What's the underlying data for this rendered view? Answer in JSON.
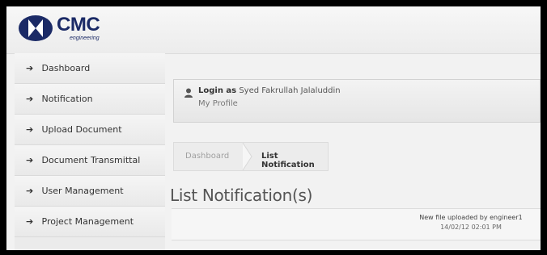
{
  "brand": {
    "name": "CMC",
    "subtitle": "engineering"
  },
  "sidebar": {
    "items": [
      {
        "label": "Dashboard"
      },
      {
        "label": "Notification"
      },
      {
        "label": "Upload Document"
      },
      {
        "label": "Document Transmittal"
      },
      {
        "label": "User Management"
      },
      {
        "label": "Project Management"
      }
    ]
  },
  "login": {
    "prefix": "Login as",
    "user": "Syed Fakrullah Jalaluddin",
    "profile_link": "My Profile"
  },
  "breadcrumb": {
    "items": [
      "Dashboard",
      "List Notification"
    ]
  },
  "page": {
    "title": "List Notification(s)"
  },
  "notifications": [
    {
      "message": "New file uploaded by engineer1",
      "time": "14/02/12 02:01 PM"
    }
  ],
  "colors": {
    "brand_navy": "#1b2a66",
    "background": "#f2f2f2",
    "frame": "#000000"
  }
}
